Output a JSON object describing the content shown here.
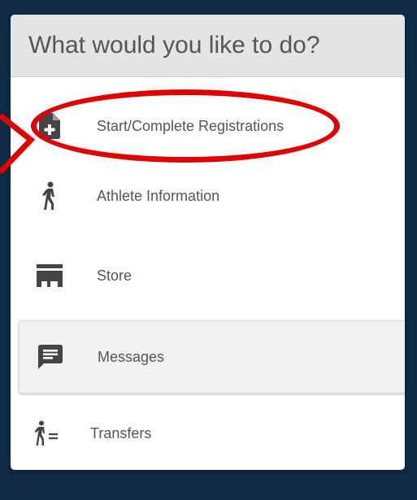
{
  "panel": {
    "title": "What would you like to do?"
  },
  "menu": {
    "items": [
      {
        "label": "Start/Complete Registrations",
        "icon": "add-document-icon"
      },
      {
        "label": "Athlete Information",
        "icon": "walking-person-icon"
      },
      {
        "label": "Store",
        "icon": "store-icon"
      },
      {
        "label": "Messages",
        "icon": "message-icon"
      },
      {
        "label": "Transfers",
        "icon": "transfer-person-icon"
      }
    ]
  },
  "colors": {
    "background": "#0e2a45",
    "panel": "#ffffff",
    "header": "#e4e4e4",
    "icon": "#444444",
    "text": "#555555",
    "annotation": "#e00000"
  }
}
